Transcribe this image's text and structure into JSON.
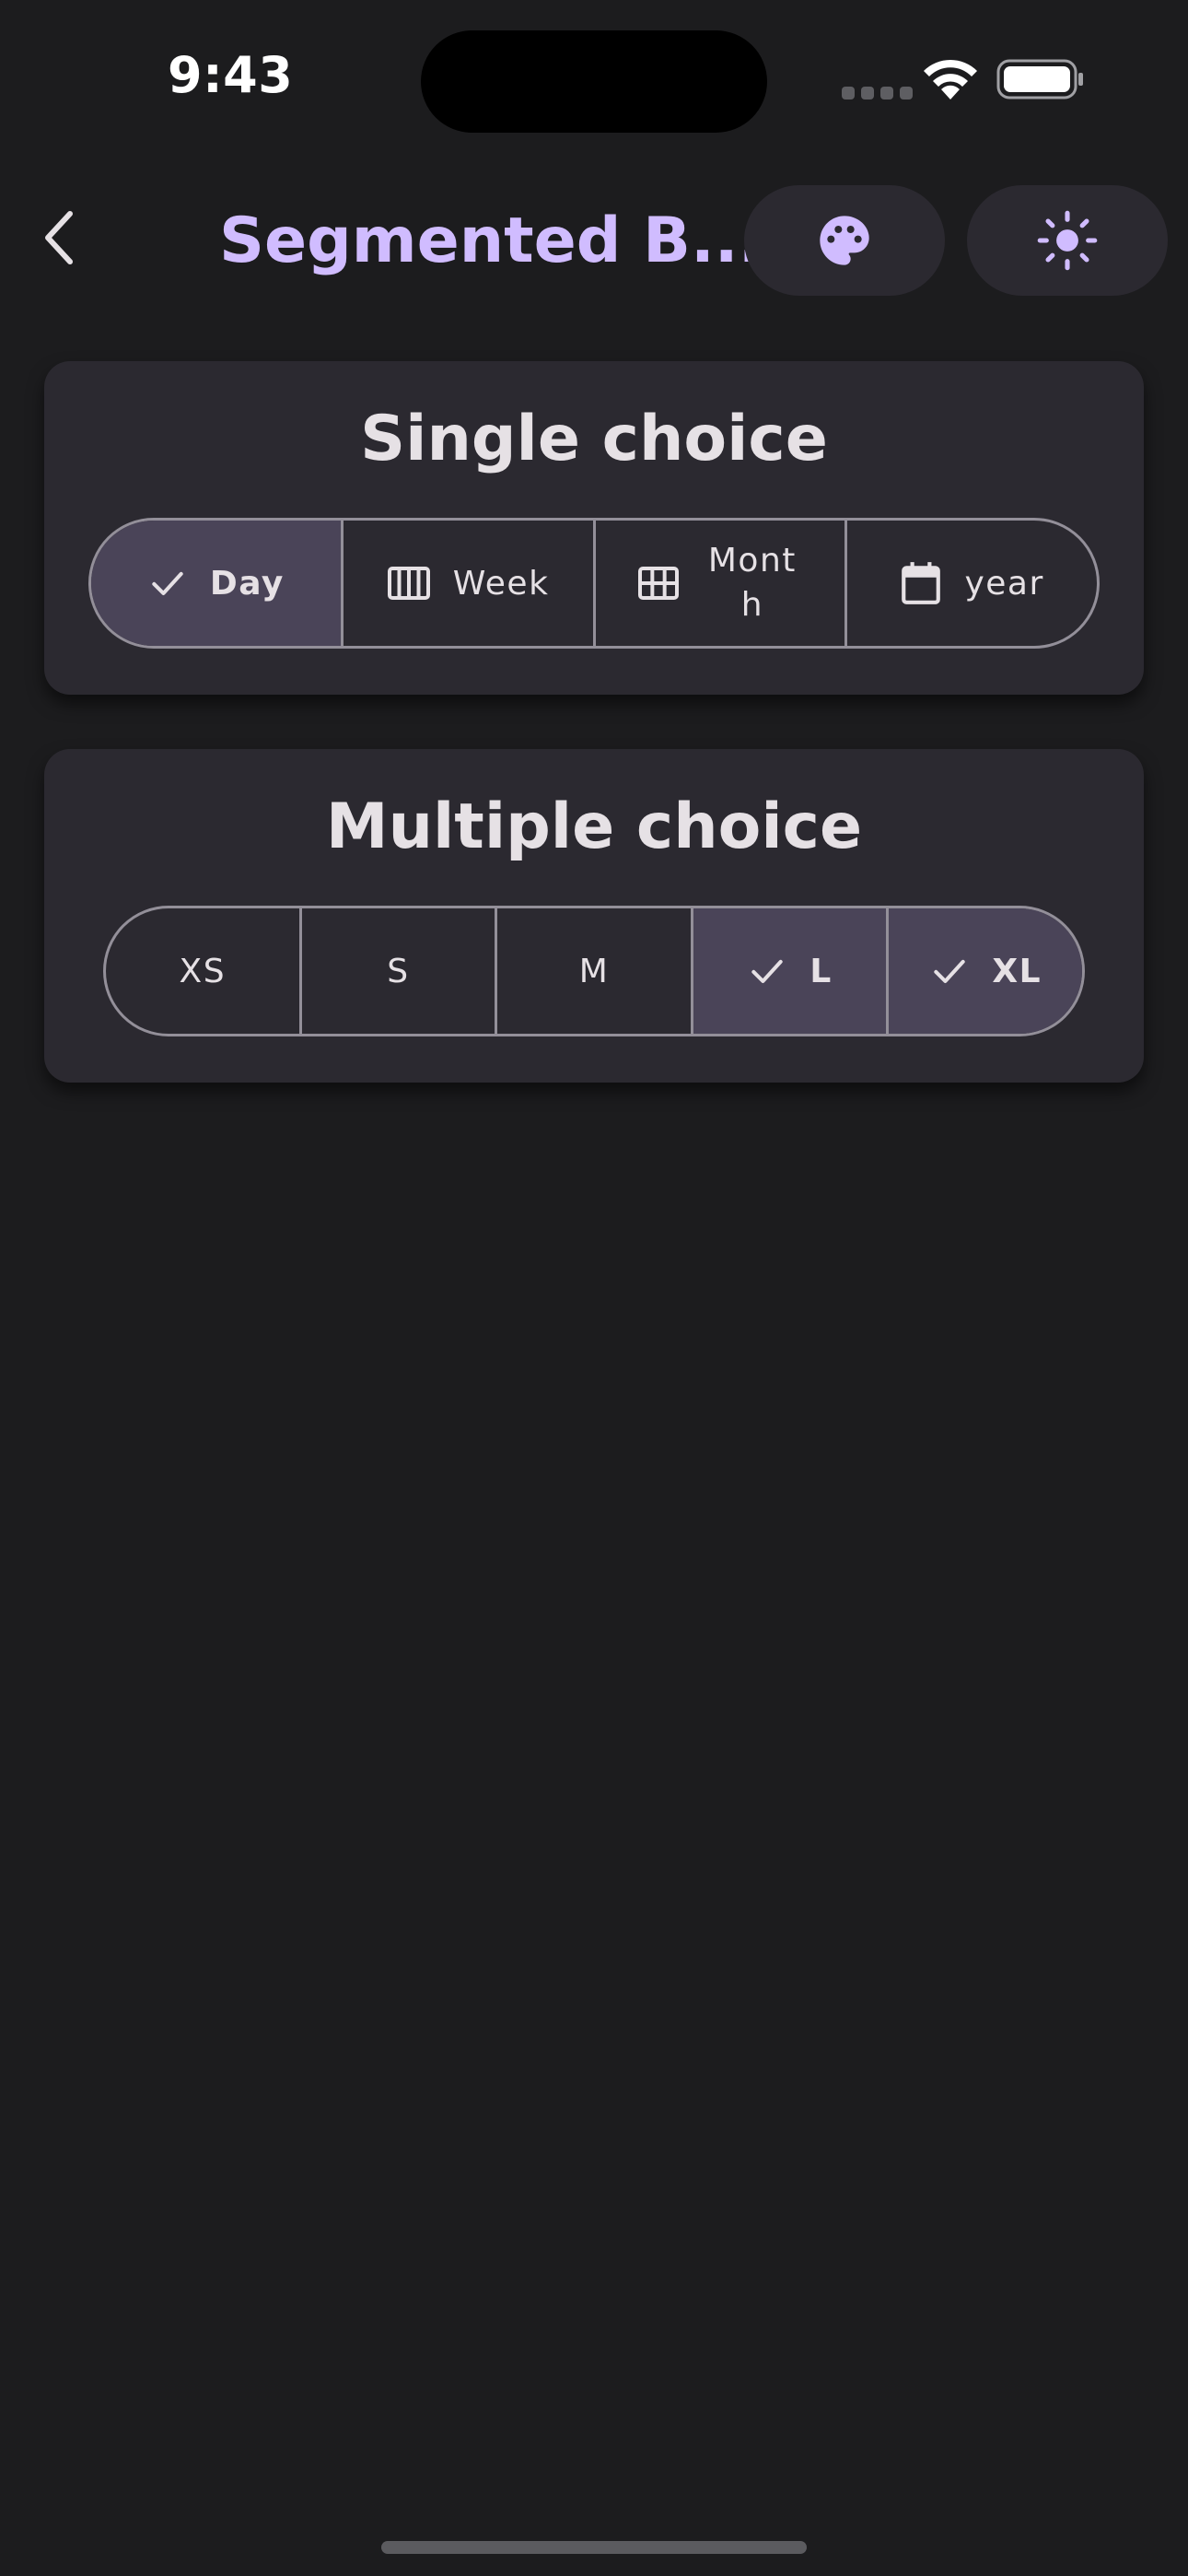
{
  "status_bar": {
    "time": "9:43"
  },
  "app_bar": {
    "title": "Segmented B...",
    "back_icon": "chevron-left-icon",
    "actions": [
      {
        "name": "palette",
        "icon": "palette-icon"
      },
      {
        "name": "theme",
        "icon": "sun-icon"
      }
    ]
  },
  "single_choice": {
    "title": "Single choice",
    "segments": [
      {
        "label": "Day",
        "icon": "check-icon",
        "selected": true
      },
      {
        "label": "Week",
        "icon": "calendar-view-week-icon",
        "selected": false
      },
      {
        "label": "Month",
        "icon": "calendar-view-month-icon",
        "selected": false
      },
      {
        "label": "year",
        "icon": "calendar-icon",
        "selected": false
      }
    ]
  },
  "multiple_choice": {
    "title": "Multiple choice",
    "segments": [
      {
        "label": "XS",
        "selected": false
      },
      {
        "label": "S",
        "selected": false
      },
      {
        "label": "M",
        "selected": false
      },
      {
        "label": "L",
        "selected": true
      },
      {
        "label": "XL",
        "selected": true
      }
    ]
  },
  "colors": {
    "background": "#1c1c1e",
    "card": "#2b2930",
    "accent": "#d0bcff",
    "selected_segment": "#4a4458",
    "outline": "#938f99",
    "text": "#e6e1e5"
  }
}
